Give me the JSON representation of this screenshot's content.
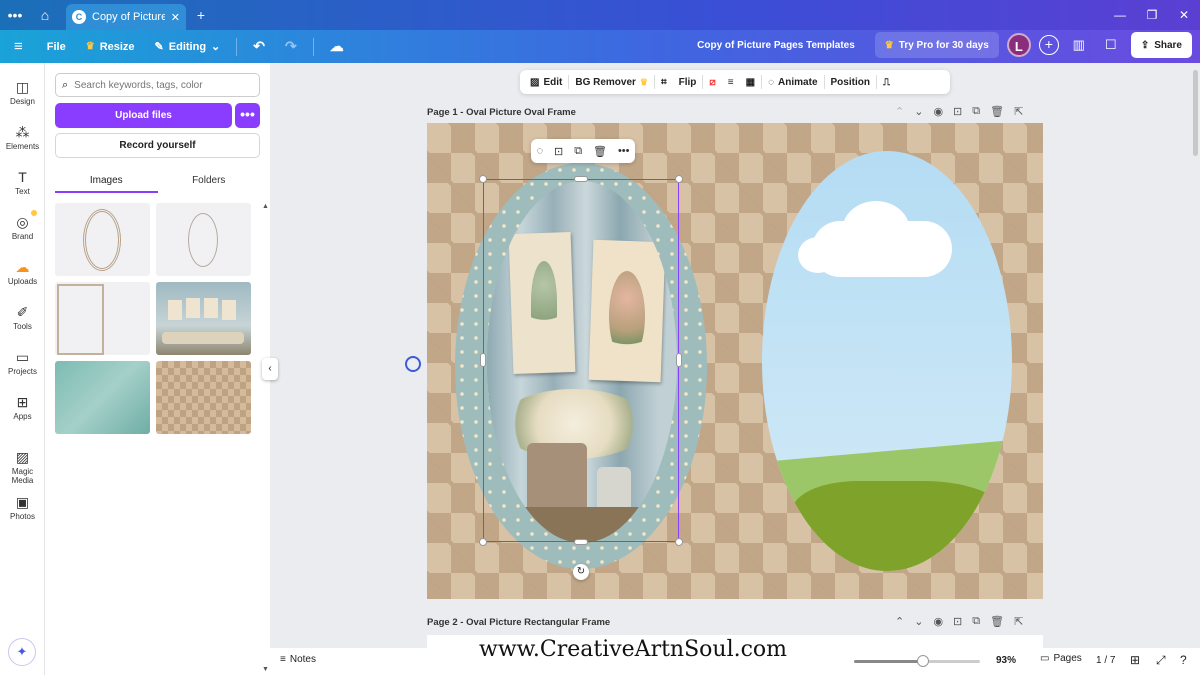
{
  "browser": {
    "tab_title": "Copy of Picture Pa...",
    "tab_favicon": "C",
    "new_tab": "+",
    "menu_icon": "•••",
    "close_tab": "✕"
  },
  "header": {
    "file": "File",
    "resize": "Resize",
    "editing": "Editing",
    "doc_title": "Copy of Picture Pages Templates",
    "try_pro": "Try Pro for 30 days",
    "avatar": "L",
    "share": "Share",
    "brand_colors": {
      "start": "#1aa3d8",
      "mid": "#3f66e0",
      "end": "#6a4be0"
    }
  },
  "rail": {
    "items": [
      {
        "label": "Design",
        "icon": "design-icon"
      },
      {
        "label": "Elements",
        "icon": "elements-icon"
      },
      {
        "label": "Text",
        "icon": "text-icon"
      },
      {
        "label": "Brand",
        "icon": "brand-icon"
      },
      {
        "label": "Uploads",
        "icon": "uploads-icon"
      },
      {
        "label": "Tools",
        "icon": "tools-icon"
      },
      {
        "label": "Projects",
        "icon": "projects-icon"
      },
      {
        "label": "Apps",
        "icon": "apps-icon"
      },
      {
        "label": "Magic Media",
        "icon": "magic-media-icon"
      },
      {
        "label": "Photos",
        "icon": "photos-icon"
      }
    ]
  },
  "panel": {
    "search_placeholder": "Search keywords, tags, color",
    "upload": "Upload files",
    "upload_more": "•••",
    "record": "Record yourself",
    "tabs": [
      "Images",
      "Folders"
    ],
    "active_tab": "Images"
  },
  "toolbar": {
    "edit": "Edit",
    "bg_remover": "BG Remover",
    "flip": "Flip",
    "animate": "Animate",
    "position": "Position"
  },
  "pages": [
    {
      "label": "Page 1 - Oval Picture Oval Frame"
    },
    {
      "label": "Page 2 - Oval Picture Rectangular Frame"
    }
  ],
  "watermark": "www.CreativeArtnSoul.com",
  "bottom": {
    "notes": "Notes",
    "zoom": "93%",
    "zoom_level": 0.55,
    "pages": "Pages",
    "page_count": "1 / 7"
  },
  "colors": {
    "accent": "#8b3dff",
    "pro_crown": "#ffc83d"
  }
}
